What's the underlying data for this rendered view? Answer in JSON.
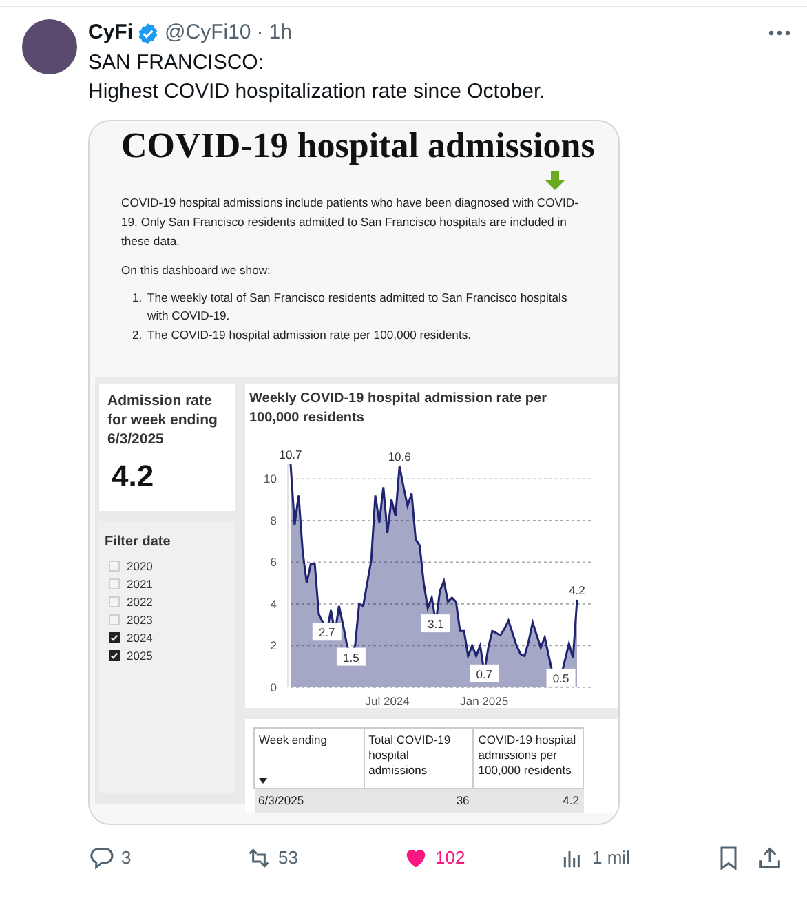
{
  "tweet": {
    "author": "CyFi",
    "verified": true,
    "handle": "@CyFi10",
    "separator": "·",
    "time": "1h",
    "text_lines": [
      "SAN FRANCISCO:",
      "Highest COVID hospitalization rate since October."
    ]
  },
  "dashboard": {
    "title": "COVID-19 hospital admissions",
    "intro": "COVID-19 hospital admissions include patients who have been diagnosed with COVID-19. Only San Francisco residents admitted to San Francisco hospitals are included in these data.",
    "list_heading": "On this dashboard we show:",
    "list_items": [
      {
        "number": "1.",
        "text": "The weekly total of San Francisco residents admitted to San Francisco hospitals with COVID-19."
      },
      {
        "number": "2.",
        "text": "The COVID-19 hospital admission rate per 100,000 residents."
      }
    ],
    "rate_card": {
      "label": "Admission rate for week ending 6/3/2025",
      "value": "4.2"
    },
    "filter": {
      "title": "Filter date",
      "options": [
        {
          "label": "2020",
          "checked": false
        },
        {
          "label": "2021",
          "checked": false
        },
        {
          "label": "2022",
          "checked": false
        },
        {
          "label": "2023",
          "checked": false
        },
        {
          "label": "2024",
          "checked": true
        },
        {
          "label": "2025",
          "checked": true
        }
      ]
    },
    "chart": {
      "chart_data": {
        "type": "area",
        "title": "Weekly COVID-19 hospital admission rate per 100,000 residents",
        "categories": [
          null,
          null,
          null,
          null,
          null,
          null,
          null,
          null,
          null,
          null,
          null,
          null,
          null,
          null,
          null,
          null,
          null,
          null,
          null,
          null,
          null,
          null,
          null,
          null,
          "Jul 2024",
          null,
          null,
          null,
          null,
          null,
          null,
          null,
          null,
          null,
          null,
          null,
          null,
          null,
          null,
          null,
          null,
          null,
          null,
          null,
          null,
          null,
          null,
          null,
          "Jan 2025",
          null,
          null,
          null,
          null,
          null,
          null,
          null,
          null,
          null,
          null,
          null,
          null,
          null,
          null,
          null,
          null,
          null,
          null,
          null,
          null,
          null,
          null,
          null
        ],
        "series": [
          {
            "color": "#1f2470",
            "values": [
              10.7,
              7.8,
              9.2,
              6.5,
              5.0,
              5.9,
              5.9,
              3.5,
              3.1,
              2.7,
              3.7,
              2.6,
              3.9,
              3.0,
              2.0,
              1.5,
              2.0,
              4.0,
              3.9,
              5.0,
              6.1,
              9.2,
              7.9,
              9.6,
              7.4,
              9.0,
              8.2,
              10.6,
              9.6,
              8.7,
              9.3,
              7.1,
              6.8,
              5.0,
              3.8,
              4.3,
              3.1,
              4.6,
              5.1,
              4.1,
              4.3,
              4.1,
              2.7,
              2.7,
              1.5,
              2.0,
              1.5,
              2.0,
              0.7,
              1.9,
              2.7,
              2.6,
              2.5,
              2.8,
              3.2,
              2.6,
              2.0,
              1.6,
              1.5,
              2.2,
              3.1,
              2.5,
              1.9,
              2.4,
              1.5,
              0.6,
              0.6,
              0.5,
              1.3,
              2.1,
              1.4,
              4.2
            ]
          }
        ],
        "ylim": [
          0,
          10.7
        ],
        "yticks": [
          0,
          2,
          4,
          6,
          8,
          10
        ],
        "grid": true,
        "value_labels": [
          "10.7",
          null,
          null,
          null,
          null,
          null,
          null,
          null,
          null,
          "2.7",
          null,
          null,
          null,
          null,
          null,
          "1.5",
          null,
          null,
          null,
          null,
          null,
          null,
          null,
          null,
          null,
          null,
          null,
          "10.6",
          null,
          null,
          null,
          null,
          null,
          null,
          null,
          null,
          "3.1",
          null,
          null,
          null,
          null,
          null,
          null,
          null,
          null,
          null,
          null,
          null,
          "0.7",
          null,
          null,
          null,
          null,
          null,
          null,
          null,
          null,
          null,
          null,
          null,
          null,
          null,
          null,
          null,
          null,
          null,
          null,
          "0.5",
          null,
          null,
          null,
          "4.2"
        ]
      }
    },
    "table": {
      "columns": [
        "Week ending",
        "Total COVID-19 hospital admissions",
        "COVID-19 hospital admissions per 100,000 residents"
      ],
      "rows": [
        [
          "6/3/2025",
          "36",
          "4.2"
        ]
      ]
    }
  },
  "actions": {
    "replies": "3",
    "reposts": "53",
    "likes": "102",
    "liked": true,
    "views": "1 mil"
  }
}
